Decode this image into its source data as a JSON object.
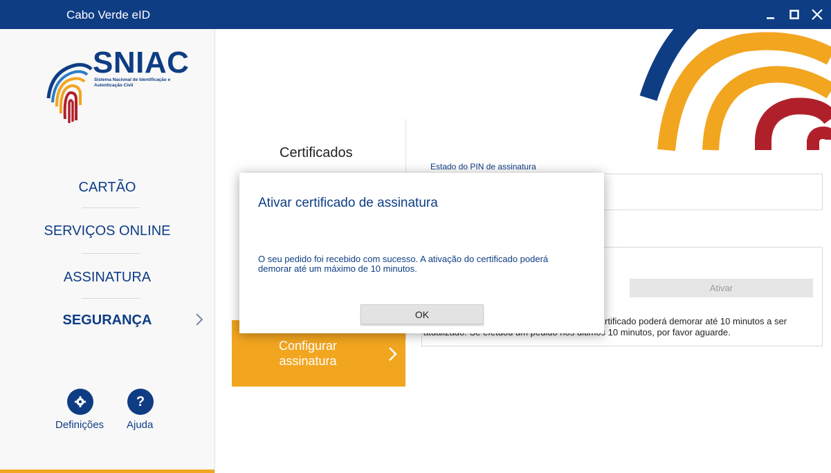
{
  "window": {
    "title": "Cabo Verde eID",
    "minimize_icon": "minimize-icon",
    "maximize_icon": "maximize-icon",
    "close_icon": "close-icon"
  },
  "logo": {
    "title": "SNIAC",
    "subtitle": "Sistema Nacional de Identificação e Autenticação Civil"
  },
  "sidebar": {
    "items": [
      {
        "label": "CARTÃO"
      },
      {
        "label": "SERVIÇOS ONLINE"
      },
      {
        "label": "ASSINATURA"
      },
      {
        "label": "SEGURANÇA",
        "selected": true
      }
    ],
    "settings_label": "Definições",
    "help_label": "Ajuda"
  },
  "main": {
    "section_title": "Certificados",
    "pin_status_label": "Estado do PIN de assinatura",
    "activate_button": "Ativar",
    "info_text": "O certificado poderá demorar até 10 minutos a ser atualizado. Se efetuou um pedido nos últimos 10 minutos, por favor aguarde.",
    "info_text_visible": "rtificado poderá demorar até 10 minutos a ser",
    "info_text_visible2": "atualizado. Se efetuou um pedido nos últimos 10 minutos, por favor aguarde.",
    "configure_button": "Configurar assinatura"
  },
  "modal": {
    "title": "Ativar certificado de assinatura",
    "body": "O seu pedido foi recebido com sucesso. A ativação do certificado poderá demorar até um máximo de 10 minutos.",
    "ok_label": "OK"
  },
  "colors": {
    "brand_blue": "#0e3d84",
    "brand_orange": "#f2a51f",
    "brand_red": "#b0202b"
  }
}
